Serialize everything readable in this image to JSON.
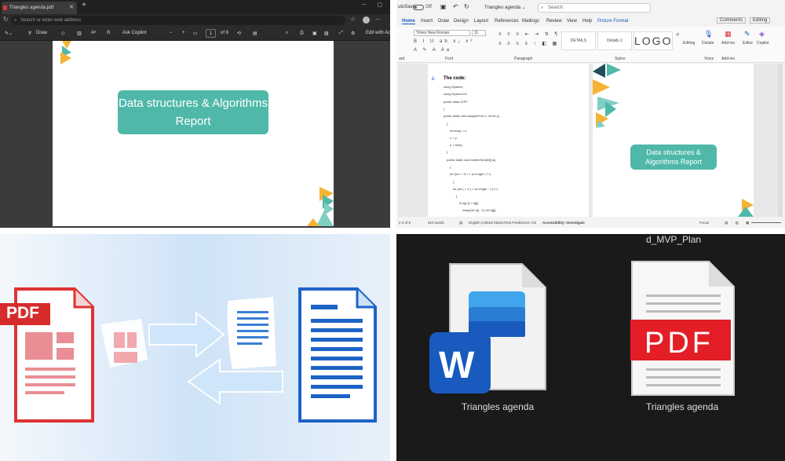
{
  "q1": {
    "tab_title": "Triangles agenda.pdf",
    "tab_close": "✕",
    "new_tab": "+",
    "address_placeholder": "Search or enter web address",
    "toolbar": {
      "draw": "Draw",
      "ask_copilot": "Ask Copilot",
      "zoom_out": "−",
      "zoom_in": "+",
      "page_current": "1",
      "page_total": "of 8",
      "edit": "Edit with Ac"
    },
    "slide_title": "Data structures & Algorithms Report"
  },
  "q2": {
    "autosave": "utoSave",
    "autosave_state": "Off",
    "doc_title": "Triangles agenda ⌄",
    "search_placeholder": "Search",
    "menu": [
      "Home",
      "Insert",
      "Draw",
      "Design",
      "Layout",
      "References",
      "Mailings",
      "Review",
      "View",
      "Help",
      "Picture Format"
    ],
    "comments": "Comments",
    "editing": "Editing",
    "font_name": "Times New Roman",
    "font_size": "11",
    "styles": [
      "DETAILS",
      "Details 2",
      "LOGO"
    ],
    "groups": [
      "Font",
      "Paragraph",
      "Styles",
      "Voice",
      "Add-ins"
    ],
    "ribbon_buttons": [
      "Editing",
      "Dictate",
      "Add-ins",
      "Editor",
      "Copilot"
    ],
    "group_left": "ard",
    "code_heading": "The code:",
    "code_lines": [
      "using System;",
      "using System.IO;",
      "public class ICPT",
      "{",
      "public static void swap(ref int x, ref int y)",
      "{",
      "int temp = x;",
      "x = y;",
      "y = temp;",
      "}",
      "public static void bubbleSort(int[] a)",
      "{",
      "for (int i = 0; i < a.Length; i++)",
      "{",
      "for (int j = 1; j < a.Length - i; j++)",
      "{",
      "if (a[j-1] > a[j])",
      "swap(ref a[j - 1], ref a[j]);"
    ],
    "slide_title": "Data structures & Algorithms Report",
    "status": {
      "page": "e 2 of 8",
      "words": "610 words",
      "lang": "English (United States)",
      "predictions": "Text Predictions: On",
      "accessibility": "Accessibility: Investigate",
      "focus": "Focus"
    }
  },
  "q3": {
    "pdf_label": "PDF"
  },
  "q4": {
    "top_name": "d_MVP_Plan",
    "word_file": "Triangles agenda",
    "word_letter": "W",
    "pdf_file": "Triangles agenda",
    "pdf_label": "PDF"
  },
  "colors": {
    "teal": "#4fb8a9",
    "word_blue": "#185abd",
    "pdf_red": "#e41e26",
    "triangle_yellow": "#f5b335"
  }
}
